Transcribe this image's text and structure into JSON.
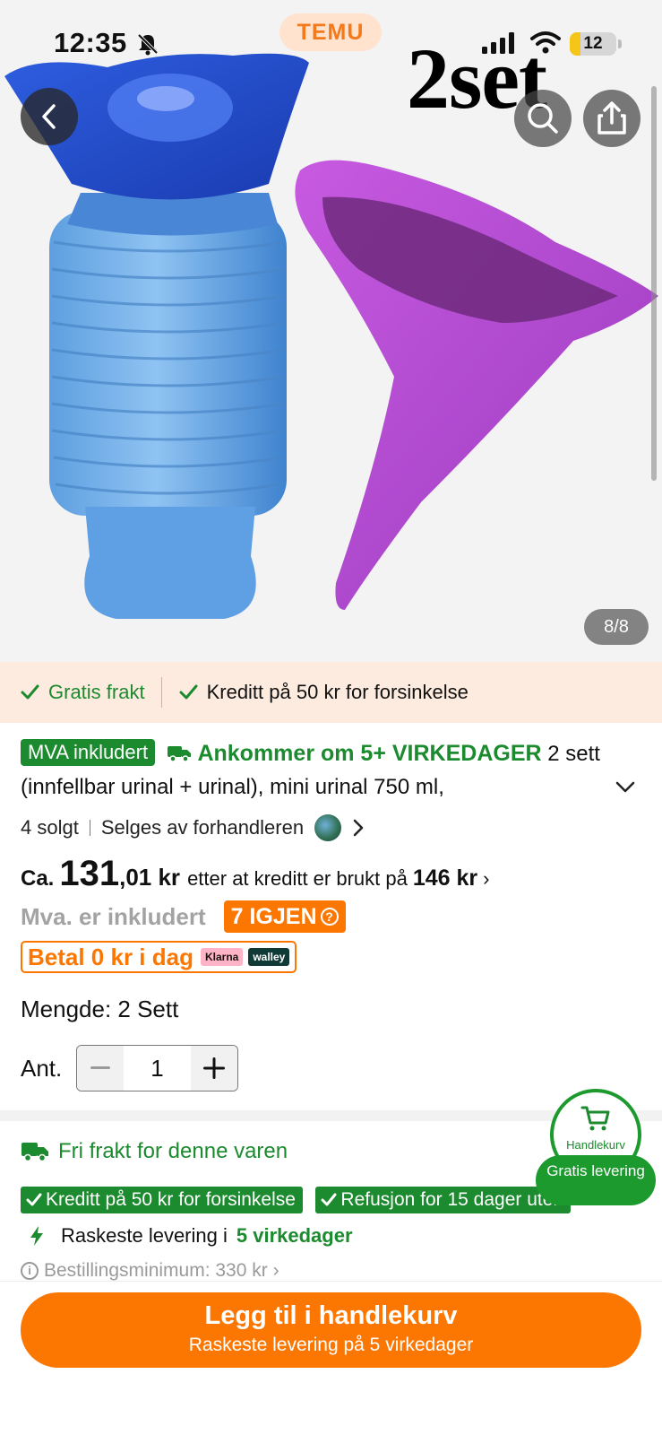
{
  "status_bar": {
    "time": "12:35",
    "app_pill": "TEMU",
    "battery": "12"
  },
  "hero": {
    "overlay_text": "2set",
    "page_counter": "8/8"
  },
  "benefit_strip": {
    "free_shipping": "Gratis frakt",
    "credit": "Kreditt på 50 kr for forsinkelse"
  },
  "product": {
    "mva_badge": "MVA inkludert",
    "arrival": "Ankommer om 5+ VIRKEDAGER",
    "title": "2 sett (innfellbar urinal + urinal), mini urinal 750 ml,",
    "sold": "4 solgt",
    "seller": "Selges av forhandleren"
  },
  "price": {
    "prefix": "Ca.",
    "integer": "131",
    "decimal": ",01 kr",
    "after_text": "etter at kreditt er brukt på",
    "before": "146 kr",
    "chevron": "›",
    "vat_note": "Mva. er inkludert",
    "stock_badge": "7 IGJEN",
    "stock_help": "?",
    "pay_today": "Betal 0 kr i dag",
    "klarna": "Klarna",
    "walley": "walley"
  },
  "quantity": {
    "variant_label": "Mengde: 2 Sett",
    "ant_label": "Ant.",
    "value": "1"
  },
  "shipping": {
    "free_for_item": "Fri frakt for denne varen",
    "chips": [
      "Kreditt på 50 kr for forsinkelse",
      "Refusjon for 15 dager uten"
    ],
    "fastest_prefix": "Raskeste levering i",
    "fastest_days": "5 virkedager",
    "order_min": "Bestillingsminimum: 330 kr ›"
  },
  "cart_float": {
    "label": "Handlekurv",
    "free_delivery": "Gratis levering"
  },
  "cta": {
    "main": "Legg til i handlekurv",
    "sub": "Raskeste levering på 5 virkedager"
  },
  "colors": {
    "accent_orange": "#fb7701",
    "green": "#1c8a2e",
    "strip_bg": "#fdebdf"
  }
}
